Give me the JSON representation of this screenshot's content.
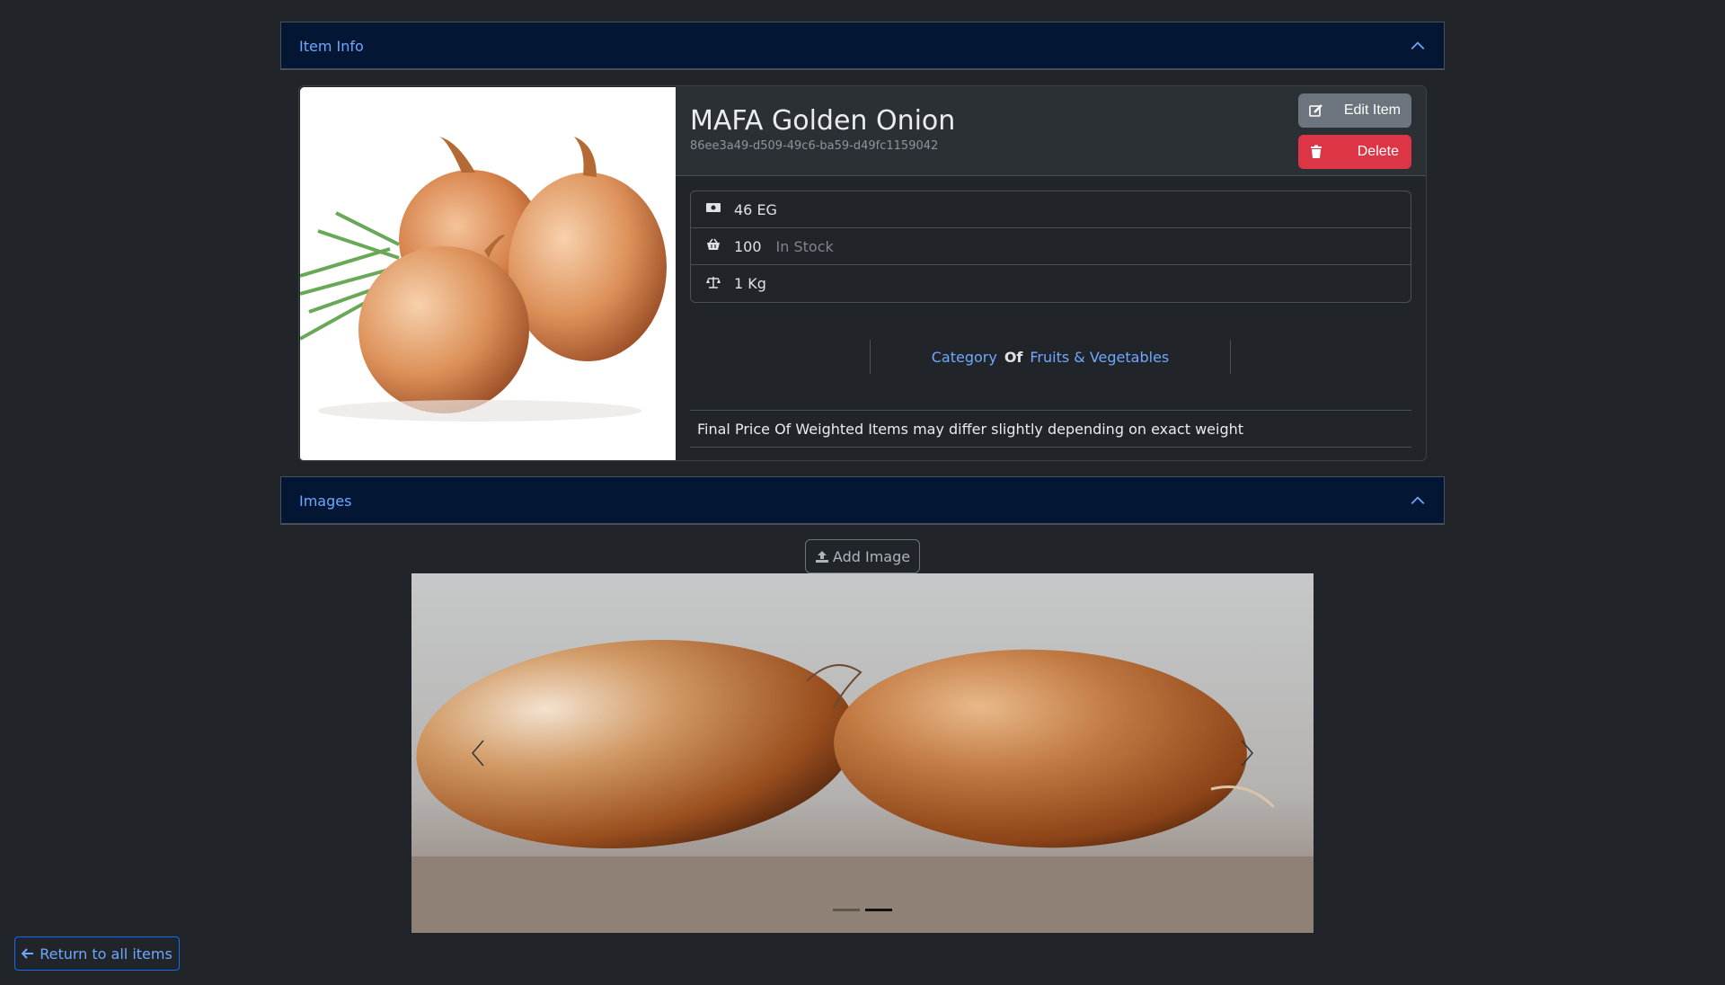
{
  "item_info": {
    "header_label": "Item Info"
  },
  "item": {
    "name": "MAFA Golden Onion",
    "id": "86ee3a49-d509-49c6-ba59-d49fc1159042",
    "price": "46 EG",
    "stock_count": "100",
    "stock_label": "In Stock",
    "weight": "1 Kg",
    "category_label": "Category",
    "category_of": "Of",
    "category_name": "Fruits & Vegetables",
    "note": "Final Price Of Weighted Items may differ slightly depending on exact weight"
  },
  "buttons": {
    "edit": "Edit Item",
    "delete": "Delete",
    "add_image": "Add Image",
    "return": "Return to all items"
  },
  "images": {
    "header_label": "Images",
    "slide_count": 2,
    "active_slide": 2
  },
  "colors": {
    "accent": "#6ea8fe",
    "danger": "#dc3545",
    "secondary": "#6c757d",
    "header_bg": "#031633",
    "page_bg": "#212529"
  },
  "icons": [
    "chevron-up-icon",
    "edit-icon",
    "trash-icon",
    "money-icon",
    "basket-icon",
    "scale-icon",
    "upload-icon",
    "chevron-left-icon",
    "chevron-right-icon",
    "arrow-left-icon"
  ]
}
